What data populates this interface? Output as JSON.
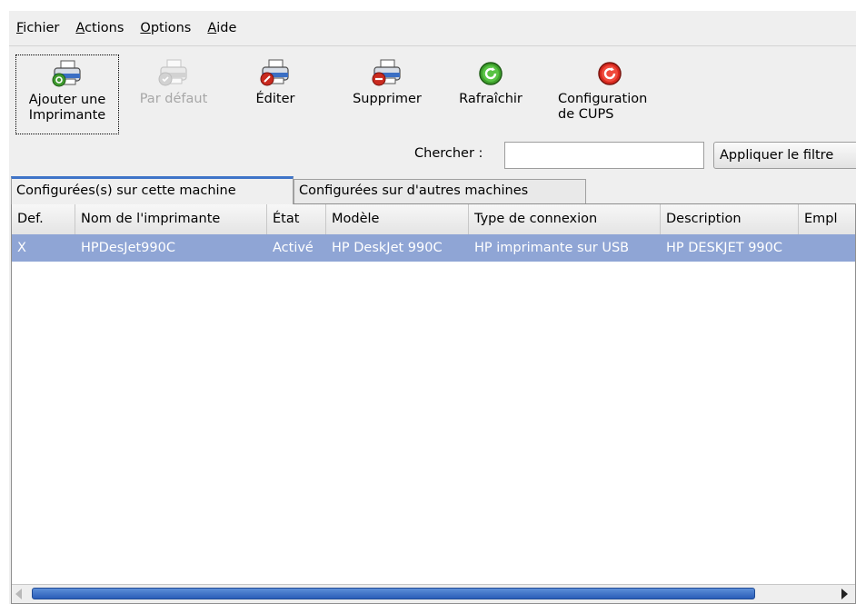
{
  "menu": [
    {
      "mnemonic": "F",
      "rest": "ichier"
    },
    {
      "mnemonic": "A",
      "rest": "ctions"
    },
    {
      "mnemonic": "O",
      "rest": "ptions"
    },
    {
      "mnemonic": "A",
      "rest": "ide"
    }
  ],
  "toolbar": {
    "add": {
      "line1": "Ajouter une",
      "line2": "Imprimante",
      "icon": "printer-add-icon"
    },
    "default": {
      "label": "Par défaut",
      "icon": "printer-default-icon"
    },
    "edit": {
      "label": "Éditer",
      "icon": "printer-edit-icon"
    },
    "delete": {
      "label": "Supprimer",
      "icon": "printer-delete-icon"
    },
    "refresh": {
      "label": "Rafraîchir",
      "icon": "refresh-icon"
    },
    "cups": {
      "line1": "Configuration",
      "line2": "de CUPS",
      "icon": "cups-config-icon"
    }
  },
  "search": {
    "label": "Chercher :",
    "value": "",
    "filter_button": "Appliquer le filtre"
  },
  "tabs": [
    "Configurées(s) sur cette machine",
    "Configurées sur d'autres machines"
  ],
  "table": {
    "headers": [
      "Def.",
      "Nom de l'imprimante",
      "État",
      "Modèle",
      "Type de connexion",
      "Description",
      "Empl"
    ],
    "rows": [
      [
        "X",
        "HPDesJet990C",
        "Activé",
        "HP DeskJet 990C",
        "HP imprimante sur USB",
        "HP DESKJET 990C",
        ""
      ]
    ]
  },
  "colors": {
    "selection": "#8fa5d5",
    "tab_accent": "#3f74c8",
    "scroll_thumb": "#2a5db8"
  }
}
